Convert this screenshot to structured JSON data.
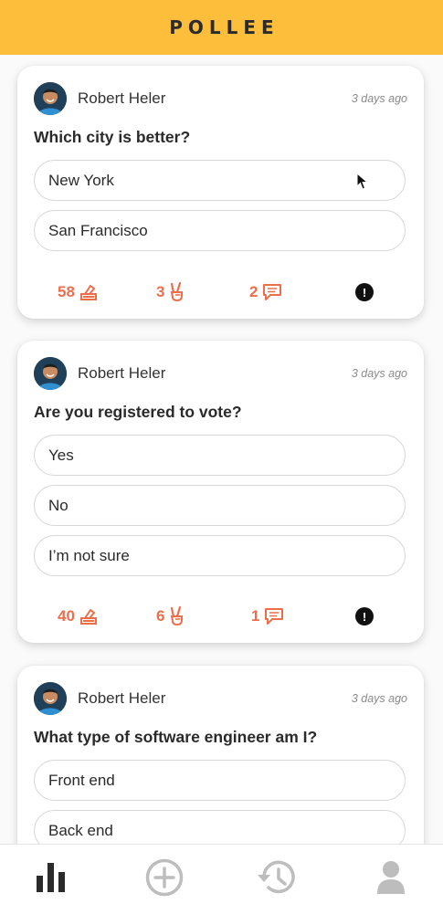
{
  "app": {
    "title": "POLLEE"
  },
  "polls": [
    {
      "author": "Robert Heler",
      "time": "3 days ago",
      "question": "Which city is better?",
      "options": [
        "New York",
        "San Francisco"
      ],
      "votes": "58",
      "peace": "3",
      "comments": "2"
    },
    {
      "author": "Robert Heler",
      "time": "3 days ago",
      "question": "Are you registered to vote?",
      "options": [
        "Yes",
        "No",
        "I’m not sure"
      ],
      "votes": "40",
      "peace": "6",
      "comments": "1"
    },
    {
      "author": "Robert Heler",
      "time": "3 days ago",
      "question": "What type of software engineer am I?",
      "options": [
        "Front end",
        "Back end"
      ]
    }
  ],
  "report_symbol": "!",
  "icons": {
    "vote": "ballot-box-icon",
    "peace": "peace-hand-icon",
    "comment": "comment-icon",
    "report": "exclamation-icon",
    "tabs": [
      "bar-chart-icon",
      "add-circle-icon",
      "history-icon",
      "profile-icon"
    ]
  },
  "colors": {
    "header": "#fdbe3b",
    "accent": "#ee6e4c",
    "tab_active": "#2b2b2b",
    "tab_inactive": "#bdbdbd"
  }
}
